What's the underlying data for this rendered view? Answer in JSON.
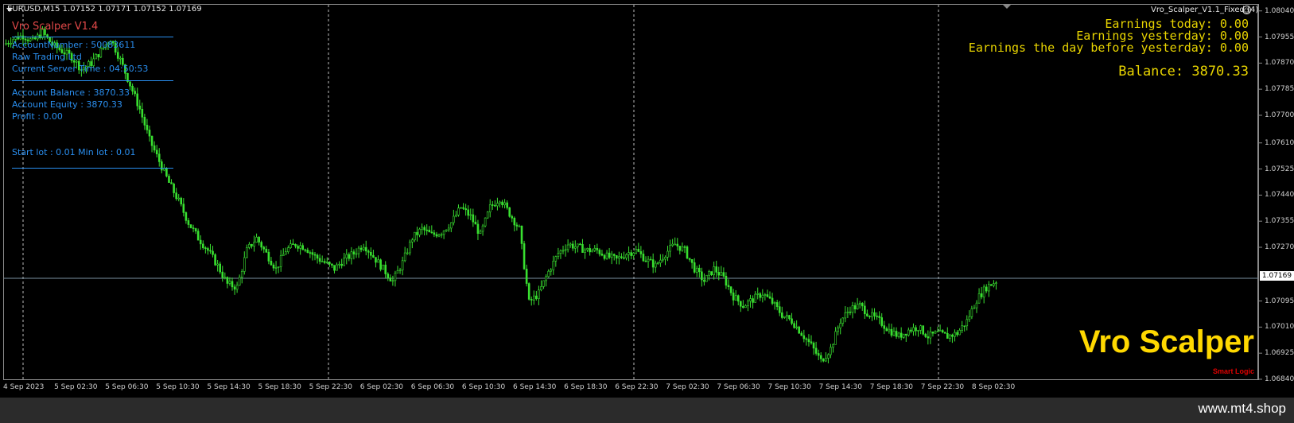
{
  "chart_header": {
    "symbol_line": "EURUSD,M15  1.07152 1.07171 1.07152 1.07169"
  },
  "expert": {
    "label": "Vro_Scalper_V1.1_Fixed (4)"
  },
  "info_panel": {
    "title": "Vro Scalper V1.4",
    "account_number": "AccountNumber : 50083611",
    "broker": "Raw Trading Ltd",
    "server_time": "Current Server Time : 04:50:53",
    "balance": "Account Balance : 3870.33",
    "equity": "Account Equity : 3870.33",
    "profit": "Profit : 0.00",
    "lots": "Start lot : 0.01  Min lot : 0.01"
  },
  "earnings": {
    "today": "Earnings today: 0.00",
    "yesterday": "Earnings yesterday: 0.00",
    "day_before": "Earnings the day before yesterday: 0.00",
    "balance": "Balance: 3870.33"
  },
  "branding": {
    "name": "Vro Scalper",
    "tagline": "Smart Logic",
    "watermark": "www.mt4.shop"
  },
  "price_axis": {
    "ticks": [
      "1.08040",
      "1.07955",
      "1.07870",
      "1.07785",
      "1.07700",
      "1.07610",
      "1.07525",
      "1.07440",
      "1.07355",
      "1.07270",
      "1.07095",
      "1.07010",
      "1.06925",
      "1.06840"
    ],
    "current_price": "1.07169"
  },
  "time_axis": {
    "ticks": [
      "4 Sep 2023",
      "5 Sep 02:30",
      "5 Sep 06:30",
      "5 Sep 10:30",
      "5 Sep 14:30",
      "5 Sep 18:30",
      "5 Sep 22:30",
      "6 Sep 02:30",
      "6 Sep 06:30",
      "6 Sep 10:30",
      "6 Sep 14:30",
      "6 Sep 18:30",
      "6 Sep 22:30",
      "7 Sep 02:30",
      "7 Sep 06:30",
      "7 Sep 10:30",
      "7 Sep 14:30",
      "7 Sep 18:30",
      "7 Sep 22:30",
      "8 Sep 02:30"
    ]
  },
  "colors": {
    "candles": "#39e030",
    "info_text": "#2a8ff0",
    "earnings_text": "#e8d400",
    "brand": "#ffd800"
  },
  "chart_data": {
    "type": "candlestick",
    "series": [
      {
        "values": [
          1.0793,
          1.0795,
          1.0796,
          1.0794,
          1.0797,
          1.0793,
          1.0791,
          1.0789,
          1.0785,
          1.0787,
          1.0791,
          1.0795,
          1.0788,
          1.078,
          1.0772,
          1.0762,
          1.0755,
          1.0748,
          1.0742,
          1.0735,
          1.073,
          1.0726,
          1.0721,
          1.0715,
          1.0714,
          1.0726,
          1.073,
          1.0725,
          1.072,
          1.0726,
          1.0728,
          1.0727,
          1.0724,
          1.0722,
          1.072,
          1.0723,
          1.0725,
          1.0728,
          1.0724,
          1.072,
          1.0716,
          1.0722,
          1.073,
          1.0733,
          1.0731,
          1.0732,
          1.0735,
          1.074,
          1.0737,
          1.0731,
          1.074,
          1.0743,
          1.0738,
          1.0733,
          1.0709,
          1.0712,
          1.0719,
          1.0725,
          1.0728,
          1.0727,
          1.0726,
          1.0726,
          1.0724,
          1.0723,
          1.0725,
          1.0726,
          1.0723,
          1.0721,
          1.0725,
          1.0728,
          1.0726,
          1.072,
          1.0716,
          1.072,
          1.0717,
          1.0711,
          1.0708,
          1.071,
          1.0712,
          1.0709,
          1.0705,
          1.0703,
          1.0699,
          1.0695,
          1.069,
          1.0694,
          1.0703,
          1.0707,
          1.0708,
          1.0705,
          1.0703,
          1.07,
          1.0698,
          1.07,
          1.0701,
          1.0698,
          1.0699,
          1.0698,
          1.0699,
          1.0703,
          1.071,
          1.0714,
          1.0716
        ]
      }
    ],
    "ylim": [
      1.0684,
      1.0806
    ]
  }
}
